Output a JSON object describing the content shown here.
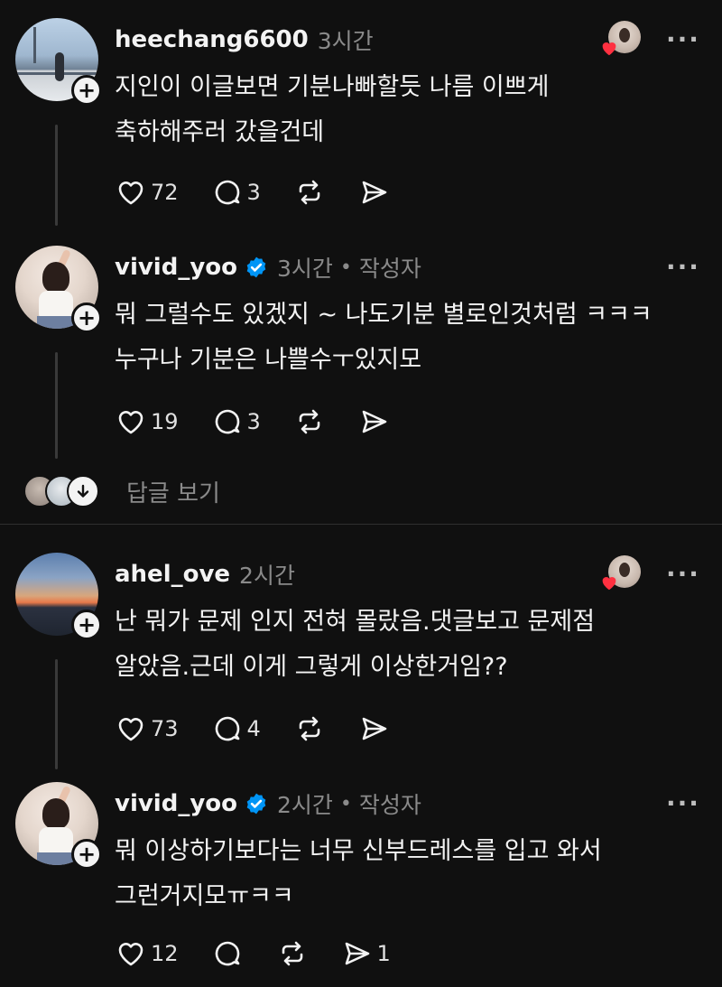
{
  "posts": [
    {
      "username": "heechang6600",
      "time": "3시간",
      "is_author": false,
      "body_lines": [
        "지인이  이글보면 기분나빠할듯  나름 이쁘게",
        "축하해주러 갔을건데"
      ],
      "likes": "72",
      "comments": "3",
      "reposts": "",
      "shares": "",
      "liked_by_author": true
    },
    {
      "username": "vivid_yoo",
      "verified": true,
      "time": "3시간",
      "author_label": "작성자",
      "body_lines": [
        "뭐 그럴수도 있겠지 ~ 나도기분 별로인것처럼 ㅋㅋㅋ",
        "누구나 기분은 나쁠수ㅜ있지모"
      ],
      "likes": "19",
      "comments": "3",
      "reposts": "",
      "shares": ""
    },
    {
      "username": "ahel_ove",
      "time": "2시간",
      "body_lines": [
        "난 뭐가 문제 인지 전혀 몰랐음.댓글보고 문제점",
        "알았음.근데 이게 그렇게 이상한거임??"
      ],
      "likes": "73",
      "comments": "4",
      "reposts": "",
      "shares": "",
      "liked_by_author": true
    },
    {
      "username": "vivid_yoo",
      "verified": true,
      "time": "2시간",
      "author_label": "작성자",
      "body_lines": [
        "뭐 이상하기보다는 너무 신부드레스를 입고 와서",
        "그런거지모ㅠㅋㅋ"
      ],
      "likes": "12",
      "comments": "",
      "reposts": "",
      "shares": "1"
    }
  ],
  "view_replies_label": "답글 보기",
  "separator": "•",
  "more_glyph": "···",
  "colors": {
    "background": "#101010",
    "text": "#f3f3f3",
    "muted": "#8a8a8a",
    "verified": "#0095f6",
    "heart": "#ff3040"
  },
  "icons": [
    "plus-icon",
    "verified-badge-icon",
    "heart-icon",
    "comment-icon",
    "repost-icon",
    "share-icon",
    "more-icon",
    "arrow-down-icon"
  ]
}
